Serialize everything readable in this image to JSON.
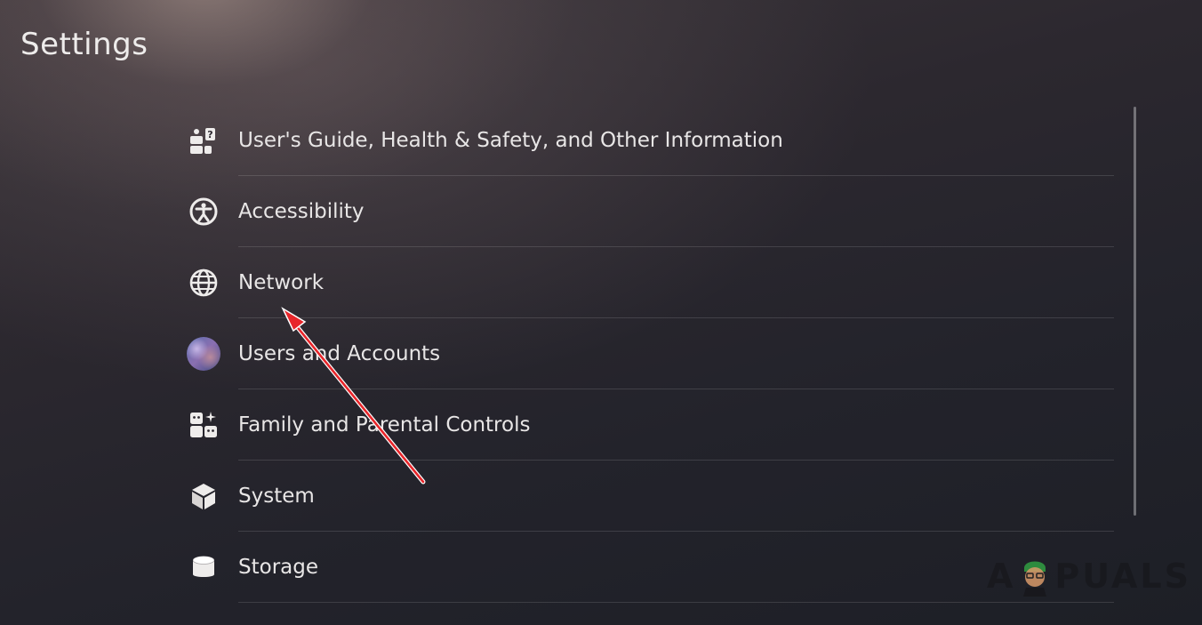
{
  "page": {
    "title": "Settings"
  },
  "menu": {
    "items": [
      {
        "label": "User's Guide, Health & Safety, and Other Information",
        "icon": "info-guide-icon"
      },
      {
        "label": "Accessibility",
        "icon": "accessibility-icon"
      },
      {
        "label": "Network",
        "icon": "globe-icon"
      },
      {
        "label": "Users and Accounts",
        "icon": "user-avatar"
      },
      {
        "label": "Family and Parental Controls",
        "icon": "family-controls-icon"
      },
      {
        "label": "System",
        "icon": "cube-icon"
      },
      {
        "label": "Storage",
        "icon": "storage-cylinder-icon"
      }
    ]
  },
  "annotation": {
    "arrow_color": "#e8262b"
  },
  "watermark": {
    "text_before": "A",
    "text_after": "PUALS"
  }
}
